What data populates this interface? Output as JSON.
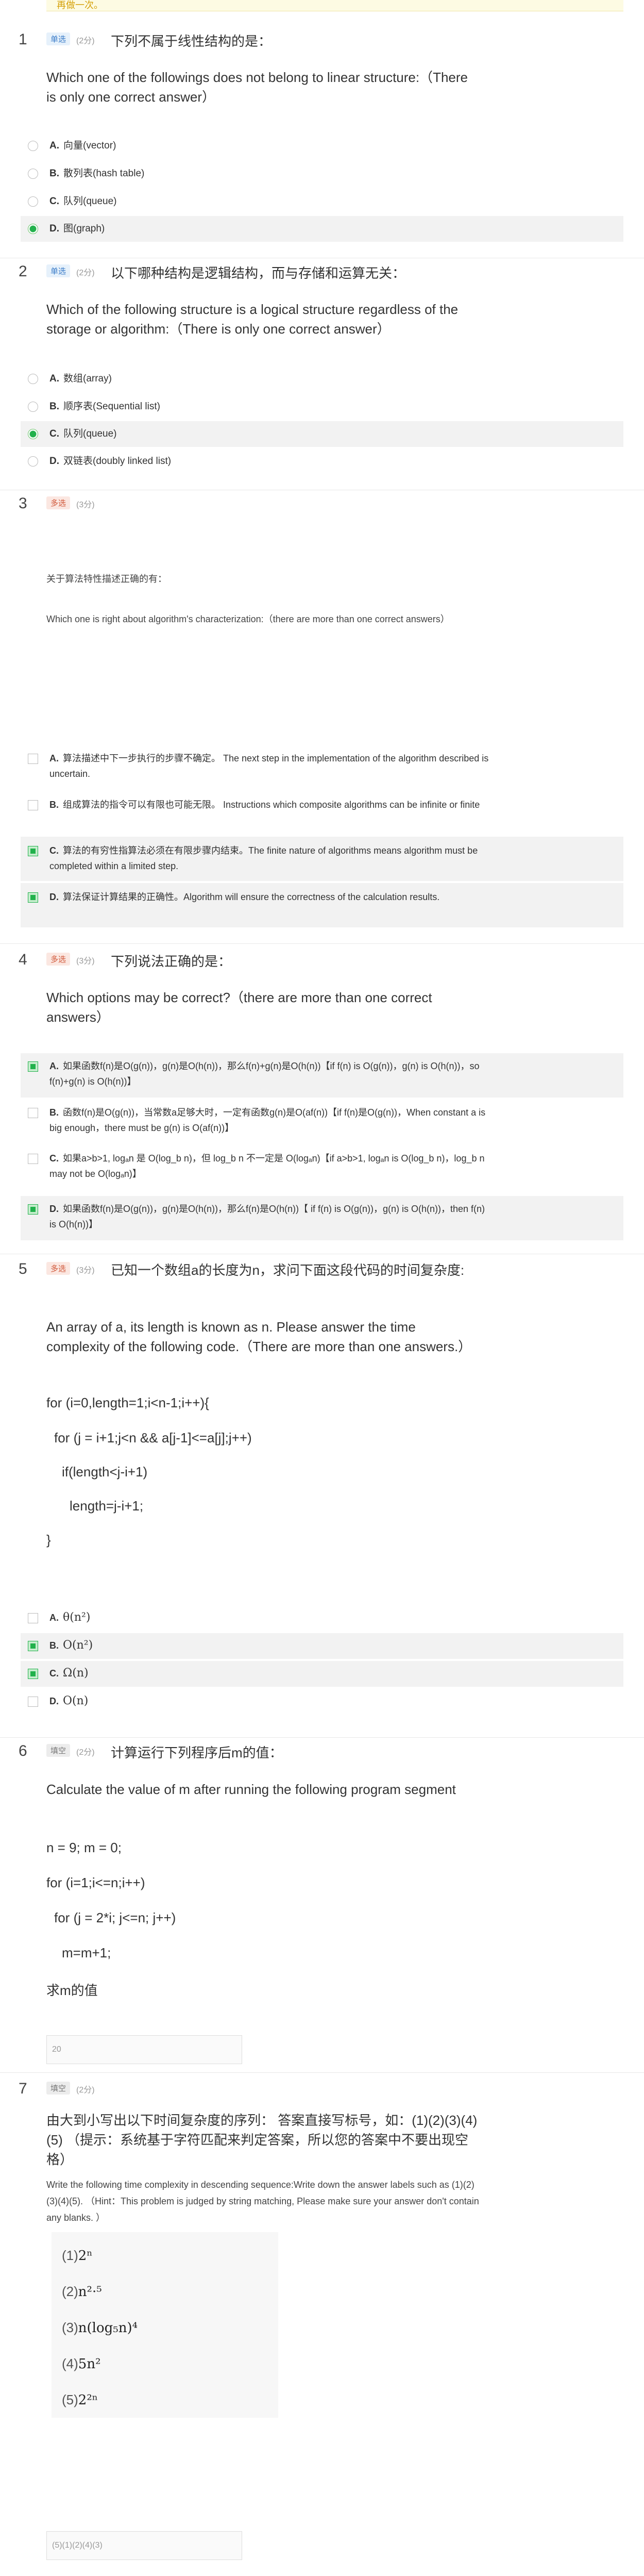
{
  "banner_text": "再做一次。",
  "questions": [
    {
      "num": "1",
      "type": "单选",
      "score": "(2分)",
      "title_cn": "下列不属于线性结构的是：",
      "title_en": "Which one of the followings does not belong to linear structure:（There is only one correct answer）",
      "options": [
        {
          "letter": "A.",
          "text": "向量(vector)"
        },
        {
          "letter": "B.",
          "text": "散列表(hash table)"
        },
        {
          "letter": "C.",
          "text": "队列(queue)"
        },
        {
          "letter": "D.",
          "text": "图(graph)"
        }
      ],
      "selected": [
        3
      ]
    },
    {
      "num": "2",
      "type": "单选",
      "score": "(2分)",
      "title_cn": "以下哪种结构是逻辑结构，而与存储和运算无关：",
      "title_en": "Which of the following structure is a logical structure regardless of the storage or algorithm:（There is only one correct answer）",
      "options": [
        {
          "letter": "A.",
          "text": "数组(array)"
        },
        {
          "letter": "B.",
          "text": "顺序表(Sequential list)"
        },
        {
          "letter": "C.",
          "text": "队列(queue)"
        },
        {
          "letter": "D.",
          "text": "双链表(doubly linked list)"
        }
      ],
      "selected": [
        2
      ]
    },
    {
      "num": "3",
      "type": "多选",
      "score": "(3分)",
      "title_cn": "关于算法特性描述正确的有：",
      "title_en": "Which one is right about algorithm's characterization:（there are more than one correct answers）",
      "options": [
        {
          "letter": "A.",
          "text": "算法描述中下一步执行的步骤不确定。 The next step in the implementation of the algorithm described is uncertain."
        },
        {
          "letter": "B.",
          "text": "组成算法的指令可以有限也可能无限。 Instructions which composite algorithms can be infinite or finite"
        },
        {
          "letter": "C.",
          "text": "算法的有穷性指算法必须在有限步骤内结束。The finite nature of algorithms means algorithm must be completed within a limited step."
        },
        {
          "letter": "D.",
          "text": "算法保证计算结果的正确性。Algorithm will ensure the correctness of the calculation results."
        }
      ],
      "selected": [
        2,
        3
      ]
    },
    {
      "num": "4",
      "type": "多选",
      "score": "(3分)",
      "title_cn": "下列说法正确的是：",
      "title_en": "Which options may be correct?（there are more than one correct answers）",
      "options": [
        {
          "letter": "A.",
          "text": "如果函数f(n)是O(g(n))，g(n)是O(h(n))，那么f(n)+g(n)是O(h(n))【if f(n) is O(g(n))，g(n) is O(h(n))，so f(n)+g(n) is O(h(n))】"
        },
        {
          "letter": "B.",
          "text": "函数f(n)是O(g(n))，当常数a足够大时，一定有函数g(n)是O(af(n))【if f(n)是O(g(n))，When constant a is big enough，there must be g(n) is O(af(n))】"
        },
        {
          "letter": "C.",
          "text": "如果a>b>1, logₐn 是 O(log_b n)，但 log_b n 不一定是 O(logₐn)【if a>b>1, logₐn is O(log_b n)，log_b n may not be O(logₐn)】"
        },
        {
          "letter": "D.",
          "text": "如果函数f(n)是O(g(n))，g(n)是O(h(n))，那么f(n)是O(h(n))【 if f(n) is O(g(n))，g(n) is O(h(n))，then f(n) is O(h(n))】"
        }
      ],
      "selected": [
        0,
        3
      ]
    },
    {
      "num": "5",
      "type": "多选",
      "score": "(3分)",
      "title_cn": "已知一个数组a的长度为n，求问下面这段代码的时间复杂度:",
      "title_en": "An array of a, its length is known as n. Please answer the time complexity of the following code.（There are more than one answers.）",
      "code": [
        "for (i=0,length=1;i<n-1;i++){",
        "  for (j = i+1;j<n && a[j-1]<=a[j];j++)",
        "    if(length<j-i+1)",
        "      length=j-i+1;",
        "}"
      ],
      "options": [
        {
          "letter": "A.",
          "text": "θ(n²)"
        },
        {
          "letter": "B.",
          "text": "O(n²)"
        },
        {
          "letter": "C.",
          "text": "Ω(n)"
        },
        {
          "letter": "D.",
          "text": "O(n)"
        }
      ],
      "selected": [
        1,
        2
      ]
    },
    {
      "num": "6",
      "type": "填空",
      "score": "(2分)",
      "title_cn": "计算运行下列程序后m的值：",
      "title_en": "Calculate the value of m after running the following program segment",
      "code": [
        "n = 9; m = 0;",
        "for (i=1;i<=n;i++)",
        "  for (j = 2*i; j<=n; j++)",
        "    m=m+1;",
        "求m的值"
      ],
      "answer": "20"
    },
    {
      "num": "7",
      "type": "填空",
      "score": "(2分)",
      "title_cn": "由大到小写出以下时间复杂度的序列： 答案直接写标号，如：(1)(2)(3)(4)(5) （提示：系统基于字符匹配来判定答案，所以您的答案中不要出现空格）",
      "title_en": "Write the following time complexity in descending sequence:Write down the answer labels such as (1)(2)(3)(4)(5). （Hint：This problem is judged by string matching, Please make sure your answer don't contain any blanks. ）",
      "formulas": [
        {
          "mark": "(1)",
          "expr": "2ⁿ"
        },
        {
          "mark": "(2)",
          "expr": "n²·⁵"
        },
        {
          "mark": "(3)",
          "expr": "n(log₅n)⁴"
        },
        {
          "mark": "(4)",
          "expr": "5n²"
        },
        {
          "mark": "(5)",
          "expr": "2²ⁿ"
        }
      ],
      "answer": "(5)(1)(2)(4)(3)"
    }
  ]
}
